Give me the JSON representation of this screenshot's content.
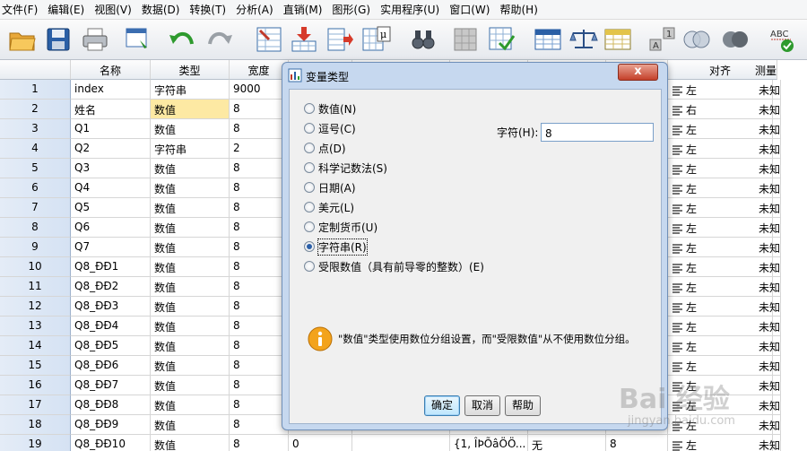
{
  "menu": [
    "文件(F)",
    "编辑(E)",
    "视图(V)",
    "数据(D)",
    "转换(T)",
    "分析(A)",
    "直销(M)",
    "图形(G)",
    "实用程序(U)",
    "窗口(W)",
    "帮助(H)"
  ],
  "toolbar_icons": [
    "open-folder-icon",
    "save-icon",
    "print-icon",
    "dialog-recall-icon",
    "undo-icon",
    "redo-icon",
    "goto-case-icon",
    "insert-case-icon",
    "insert-variable-icon",
    "variables-icon",
    "find-icon",
    "split-file-icon",
    "select-cases-icon",
    "weight-cases-icon",
    "value-labels-icon",
    "use-sets-icon",
    "show-all-icon",
    "spelling-icon"
  ],
  "grid": {
    "columns": [
      "名称",
      "类型",
      "宽度",
      "",
      "",
      "",
      "",
      "",
      "对齐",
      "测量"
    ],
    "rows": [
      {
        "n": "1",
        "name": "index",
        "type": "字符串",
        "width": "9000",
        "align": "左",
        "measure": "未知"
      },
      {
        "n": "2",
        "name": "姓名",
        "type": "数值",
        "width": "8",
        "align": "右",
        "measure": "未知"
      },
      {
        "n": "3",
        "name": "Q1",
        "type": "数值",
        "width": "8",
        "align": "左",
        "measure": "未知"
      },
      {
        "n": "4",
        "name": "Q2",
        "type": "字符串",
        "width": "2",
        "align": "左",
        "measure": "未知"
      },
      {
        "n": "5",
        "name": "Q3",
        "type": "数值",
        "width": "8",
        "align": "左",
        "measure": "未知"
      },
      {
        "n": "6",
        "name": "Q4",
        "type": "数值",
        "width": "8",
        "align": "左",
        "measure": "未知"
      },
      {
        "n": "7",
        "name": "Q5",
        "type": "数值",
        "width": "8",
        "align": "左",
        "measure": "未知"
      },
      {
        "n": "8",
        "name": "Q6",
        "type": "数值",
        "width": "8",
        "align": "左",
        "measure": "未知"
      },
      {
        "n": "9",
        "name": "Q7",
        "type": "数值",
        "width": "8",
        "align": "左",
        "measure": "未知"
      },
      {
        "n": "10",
        "name": "Q8_ÐÐ1",
        "type": "数值",
        "width": "8",
        "align": "左",
        "measure": "未知"
      },
      {
        "n": "11",
        "name": "Q8_ÐÐ2",
        "type": "数值",
        "width": "8",
        "align": "左",
        "measure": "未知"
      },
      {
        "n": "12",
        "name": "Q8_ÐÐ3",
        "type": "数值",
        "width": "8",
        "align": "左",
        "measure": "未知"
      },
      {
        "n": "13",
        "name": "Q8_ÐÐ4",
        "type": "数值",
        "width": "8",
        "align": "左",
        "measure": "未知"
      },
      {
        "n": "14",
        "name": "Q8_ÐÐ5",
        "type": "数值",
        "width": "8",
        "align": "左",
        "measure": "未知"
      },
      {
        "n": "15",
        "name": "Q8_ÐÐ6",
        "type": "数值",
        "width": "8",
        "align": "左",
        "measure": "未知"
      },
      {
        "n": "16",
        "name": "Q8_ÐÐ7",
        "type": "数值",
        "width": "8",
        "align": "左",
        "measure": "未知"
      },
      {
        "n": "17",
        "name": "Q8_ÐÐ8",
        "type": "数值",
        "width": "8",
        "align": "左",
        "measure": "未知"
      },
      {
        "n": "18",
        "name": "Q8_ÐÐ9",
        "type": "数值",
        "width": "8",
        "align": "左",
        "measure": "未知"
      },
      {
        "n": "19",
        "name": "Q8_ÐÐ10",
        "type": "数值",
        "width": "8",
        "decimals": "0",
        "values": "{1, ÎÞÕâÖÖ...",
        "missing": "无",
        "columns": "8",
        "align": "左",
        "measure": "未知"
      }
    ],
    "selected_row": 2
  },
  "dialog": {
    "title": "变量类型",
    "close": "x",
    "options": [
      {
        "label": "数值(N)",
        "checked": false
      },
      {
        "label": "逗号(C)",
        "checked": false
      },
      {
        "label": "点(D)",
        "checked": false
      },
      {
        "label": "科学记数法(S)",
        "checked": false
      },
      {
        "label": "日期(A)",
        "checked": false
      },
      {
        "label": "美元(L)",
        "checked": false
      },
      {
        "label": "定制货币(U)",
        "checked": false
      },
      {
        "label": "字符串(R)",
        "checked": true
      },
      {
        "label": "受限数值（具有前导零的整数）(E)",
        "checked": false
      }
    ],
    "width_label": "字符(H):",
    "width_value": "8",
    "info": "\"数值\"类型使用数位分组设置，而\"受限数值\"从不使用数位分组。",
    "buttons": {
      "ok": "确定",
      "cancel": "取消",
      "help": "帮助"
    }
  },
  "watermark": "Bai 经验",
  "watermark_url": "jingyan.baidu.com"
}
